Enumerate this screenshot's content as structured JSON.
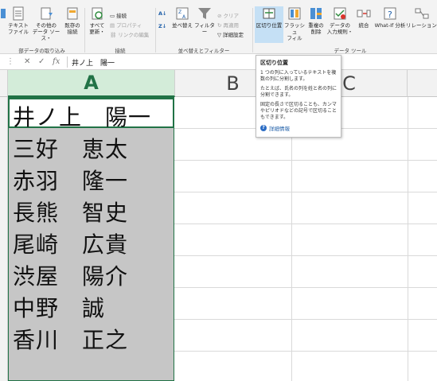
{
  "ribbon": {
    "groups": {
      "get_external_data_label": "部データの取り込み",
      "connections_label": "接続",
      "sort_filter_label": "並べ替えとフィルター",
      "data_tools_label": "データ ツール"
    },
    "buttons": {
      "text_file": "テキスト\nファイル",
      "other_sources": "その他の\nデータ ソース・",
      "existing_connections": "既存の\n接続",
      "refresh_all": "すべて\n更新・",
      "connections": "接続",
      "properties": "プロパティ",
      "edit_links": "リンクの編集",
      "sort": "並べ替え",
      "filter": "フィルター",
      "clear": "クリア",
      "reapply": "再適用",
      "advanced": "詳細設定",
      "text_to_columns": "区切り位置",
      "flash_fill": "フラッシュ\nフィル",
      "remove_duplicates": "重複の\n削除",
      "data_validation": "データの\n入力規則・",
      "consolidate": "統合",
      "what_if": "What-If 分析",
      "relationships": "リレーションシ"
    }
  },
  "formula_bar": {
    "cancel": "✕",
    "enter": "✓",
    "fx": "fx",
    "content": "井ノ上　陽一"
  },
  "grid": {
    "columns": [
      "A",
      "B",
      "C"
    ],
    "cells_a": [
      "井ノ上　陽一",
      "三好　恵太",
      "赤羽　隆一",
      "長熊　智史",
      "尾崎　広貴",
      "渋屋　陽介",
      "中野　誠",
      "香川　正之"
    ]
  },
  "tooltip": {
    "title": "区切り位置",
    "p1": "1 つの列に入っているテキストを複数の列に分割します。",
    "p2": "たとえば、氏名の列を姓と名の列に分割できます。",
    "p3": "固定の長さで区切ることも、カンマやピリオドなどの記号で区切ることもできます。",
    "link": "詳細情報"
  },
  "colors": {
    "accent": "#217346",
    "selection_fill": "#c6c6c6"
  }
}
